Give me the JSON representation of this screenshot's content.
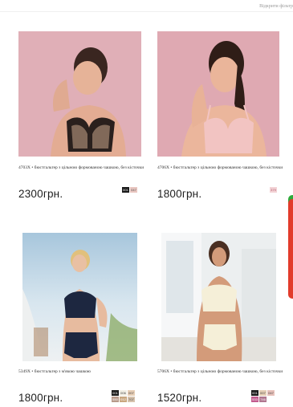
{
  "header": {
    "filter_link": "Відкрити фільтр"
  },
  "products": [
    {
      "description": "4703X • бюстгальтер з цільною формованою чашкою, без кісточки",
      "price": "2300грн.",
      "swatches": [
        [
          "001",
          "047"
        ]
      ],
      "swatch_colors": [
        [
          "#1a1a1a",
          "#e9c6c0"
        ]
      ]
    },
    {
      "description": "4706X • бюстгальтер з цільною формованою чашкою, без кісточки",
      "price": "1800грн.",
      "swatches": [
        [
          "379"
        ]
      ],
      "swatch_colors": [
        [
          "#f3d3d6"
        ]
      ]
    },
    {
      "description": "5349X • бюстгальтер з м'якою чашкою",
      "price": "1800грн.",
      "swatches": [
        [
          "001",
          "006",
          "007"
        ],
        [
          "550",
          "012",
          "707"
        ]
      ],
      "swatch_colors": [
        [
          "#1a1a1a",
          "#f2efe4",
          "#e8cfb6"
        ],
        [
          "#b89a8a",
          "#c9a77f",
          "#d7c3ad"
        ]
      ]
    },
    {
      "description": "5706X • бюстгальтер з цільною формованою чашкою, без кісточки",
      "price": "1520грн.",
      "swatches": [
        [
          "001",
          "007",
          "047"
        ],
        [
          "533",
          "746"
        ]
      ],
      "swatch_colors": [
        [
          "#1a1a1a",
          "#e6cfb5",
          "#e8c2bb"
        ],
        [
          "#c25b8e",
          "#b0768f"
        ]
      ]
    }
  ]
}
